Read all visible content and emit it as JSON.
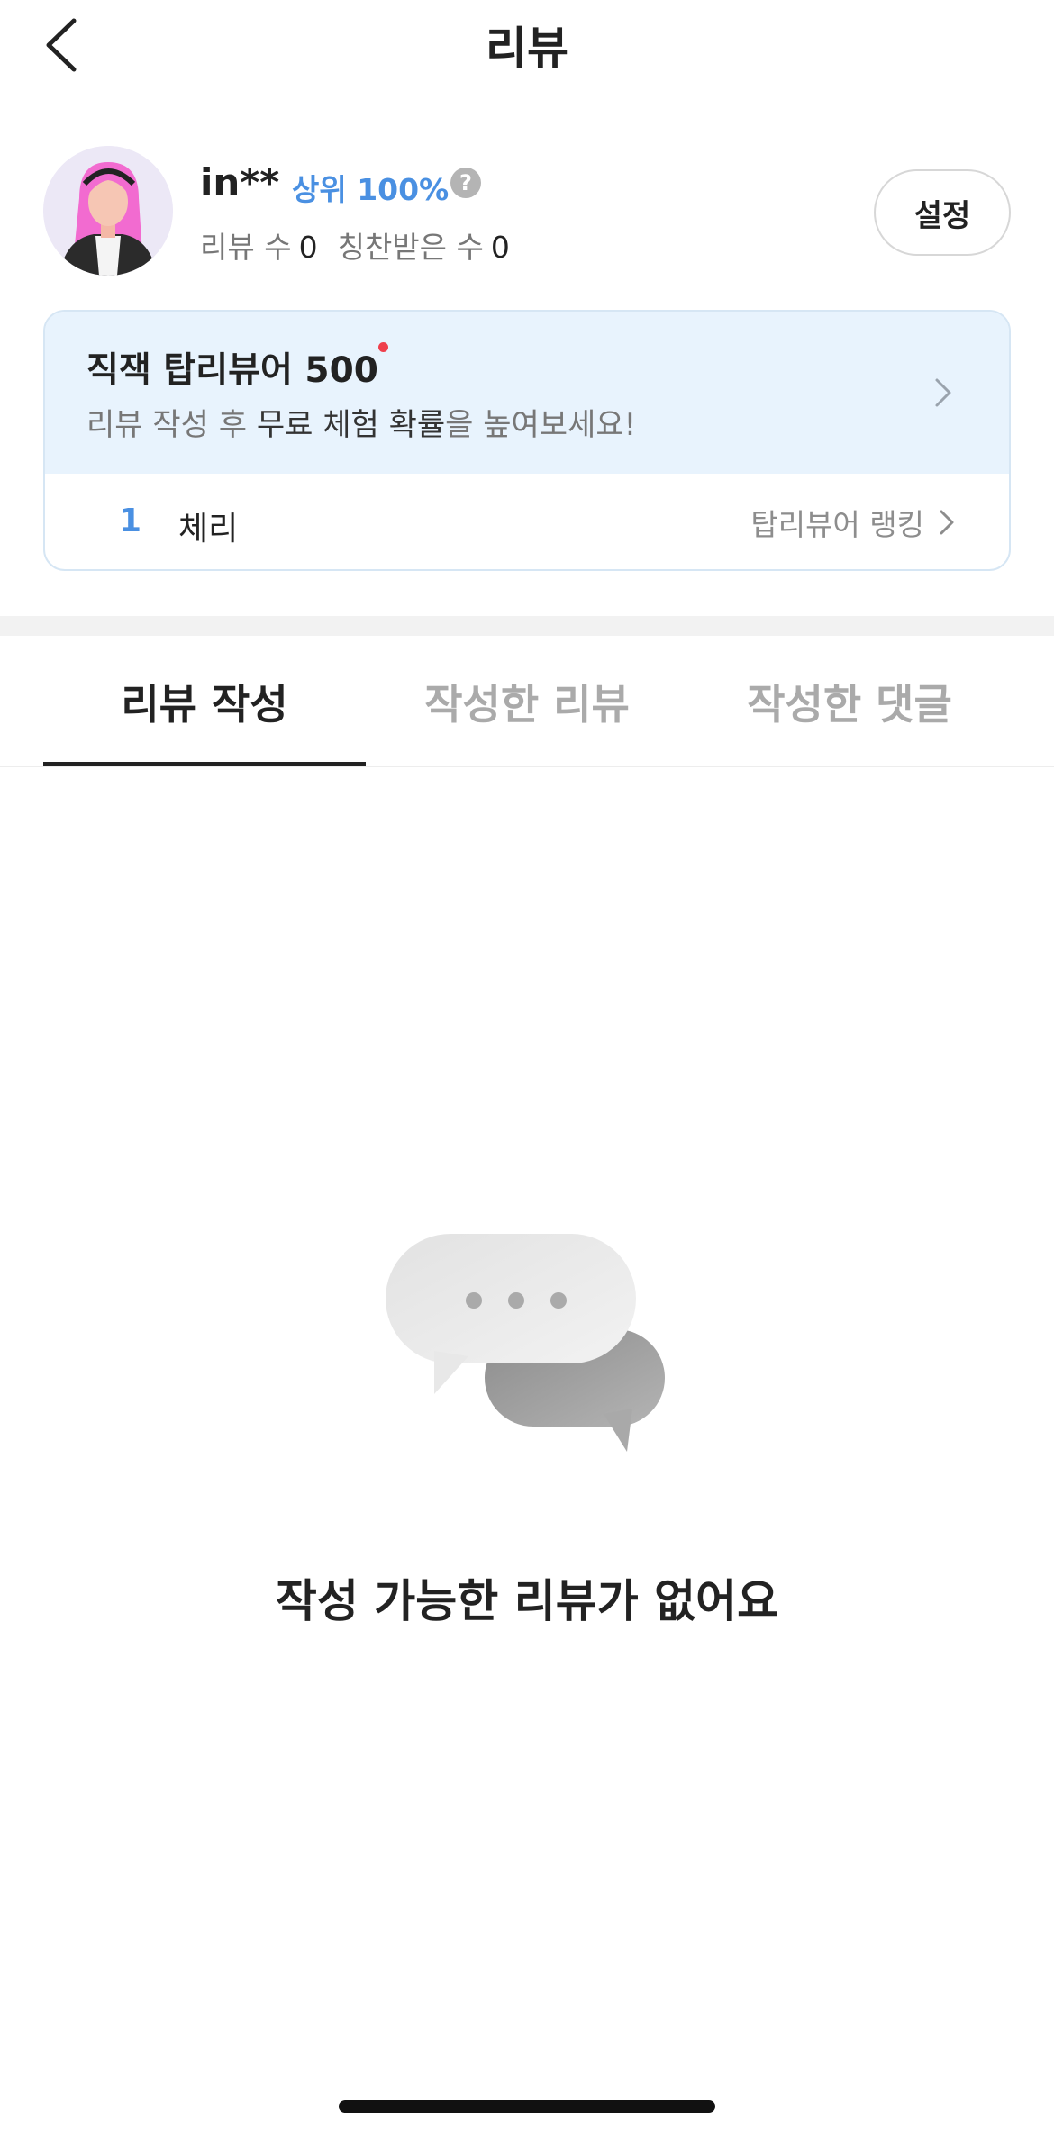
{
  "header": {
    "title": "리뷰",
    "back_icon": "chevron-left-icon"
  },
  "profile": {
    "username": "in**",
    "rank_text": "상위 100%",
    "help_icon_text": "?",
    "review_count_label": "리뷰 수",
    "review_count": "0",
    "praise_count_label": "칭찬받은 수",
    "praise_count": "0",
    "settings_label": "설정"
  },
  "top_reviewer_card": {
    "title": "직잭 탑리뷰어 500",
    "desc_prefix": "리뷰 작성 후 ",
    "desc_emphasis": "무료 체험 확률",
    "desc_suffix": "을 높여보세요!",
    "rank_number": "1",
    "rank_name": "체리",
    "ranking_link_label": "탑리뷰어 랭킹"
  },
  "tabs": [
    {
      "label": "리뷰 작성",
      "active": true
    },
    {
      "label": "작성한 리뷰",
      "active": false
    },
    {
      "label": "작성한 댓글",
      "active": false
    }
  ],
  "empty_state": {
    "icon": "chat-bubbles-icon",
    "message": "작성 가능한 리뷰가 없어요"
  },
  "colors": {
    "accent_blue": "#4a90e2",
    "card_bg": "#e8f3fd",
    "notification_dot": "#ef3f4c"
  }
}
